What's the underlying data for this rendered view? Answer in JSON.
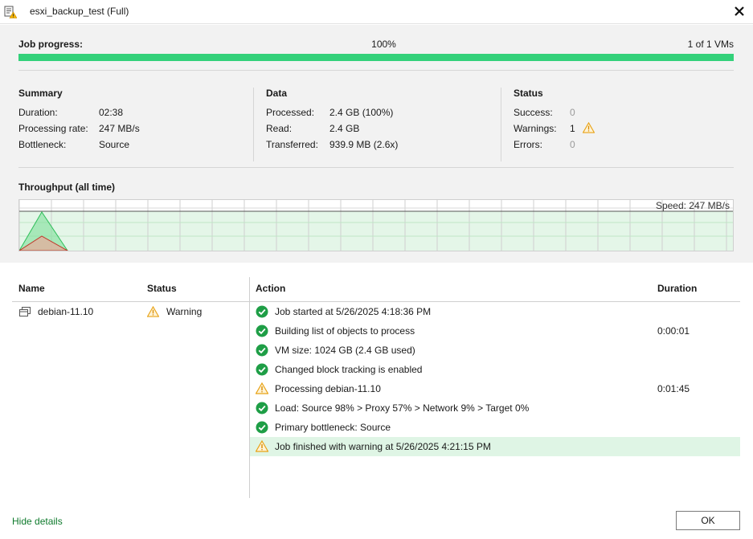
{
  "window": {
    "title": "esxi_backup_test (Full)",
    "close_icon": "close-icon",
    "app_icon": "job-report-icon"
  },
  "job_progress": {
    "label": "Job progress:",
    "percent_text": "100%",
    "percent_value": 100,
    "vm_count": "1 of 1 VMs",
    "bar_color": "#33d17a"
  },
  "summary": {
    "title": "Summary",
    "rows": [
      {
        "label": "Duration:",
        "value": "02:38"
      },
      {
        "label": "Processing rate:",
        "value": "247 MB/s"
      },
      {
        "label": "Bottleneck:",
        "value": "Source"
      }
    ]
  },
  "data_section": {
    "title": "Data",
    "rows": [
      {
        "label": "Processed:",
        "value": "2.4 GB (100%)"
      },
      {
        "label": "Read:",
        "value": "2.4 GB"
      },
      {
        "label": "Transferred:",
        "value": "939.9 MB (2.6x)"
      }
    ]
  },
  "status_section": {
    "title": "Status",
    "rows": [
      {
        "label": "Success:",
        "value": "0"
      },
      {
        "label": "Warnings:",
        "value": "1"
      },
      {
        "label": "Errors:",
        "value": "0"
      }
    ]
  },
  "throughput": {
    "title": "Throughput (all time)",
    "speed_text": "Speed: 247 MB/s",
    "grid_color": "#c8e6cc",
    "fill_color": "#dff5e5"
  },
  "table": {
    "headers": {
      "name": "Name",
      "status": "Status",
      "action": "Action",
      "duration": "Duration"
    },
    "vm": {
      "name": "debian-11.10",
      "status": "Warning",
      "icon": "vm-icon"
    },
    "actions": [
      {
        "icon": "success",
        "text": "Job started at 5/26/2025 4:18:36 PM",
        "duration": ""
      },
      {
        "icon": "success",
        "text": "Building list of objects to process",
        "duration": "0:00:01"
      },
      {
        "icon": "success",
        "text": "VM size: 1024 GB (2.4 GB used)",
        "duration": ""
      },
      {
        "icon": "success",
        "text": "Changed block tracking is enabled",
        "duration": ""
      },
      {
        "icon": "warning",
        "text": "Processing debian-11.10",
        "duration": "0:01:45"
      },
      {
        "icon": "success",
        "text": "Load: Source 98% > Proxy 57% > Network 9% > Target 0%",
        "duration": ""
      },
      {
        "icon": "success",
        "text": "Primary bottleneck: Source",
        "duration": ""
      },
      {
        "icon": "warning",
        "text": "Job finished with warning at 5/26/2025 4:21:15 PM",
        "duration": "",
        "highlight": true
      }
    ]
  },
  "footer": {
    "hide_details": "Hide details",
    "ok": "OK"
  }
}
